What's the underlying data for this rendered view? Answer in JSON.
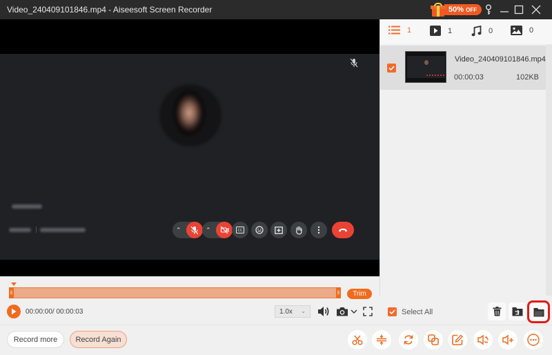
{
  "window": {
    "title": "Video_240409101846.mp4  -  Aiseesoft Screen Recorder",
    "promo_label": "50%",
    "promo_suffix": "OFF"
  },
  "player": {
    "current_time": "00:00:00",
    "total_time": "00:00:03",
    "time_display": "00:00:00/ 00:00:03",
    "speed": "1.0x",
    "trim_label": "Trim",
    "progress_fraction": 0.0
  },
  "media_tabs": [
    {
      "name": "all",
      "icon": "list-icon",
      "count": "1",
      "active": true
    },
    {
      "name": "video",
      "icon": "video-icon",
      "count": "1",
      "active": false
    },
    {
      "name": "audio",
      "icon": "music-icon",
      "count": "0",
      "active": false
    },
    {
      "name": "image",
      "icon": "image-icon",
      "count": "0",
      "active": false
    }
  ],
  "recordings": [
    {
      "filename": "Video_240409101846.mp4",
      "duration": "00:00:03",
      "size": "102KB",
      "checked": true
    }
  ],
  "list_actions": {
    "select_all_label": "Select All",
    "select_all_checked": true,
    "buttons": [
      "delete-icon",
      "export-folder-icon",
      "open-folder-icon"
    ]
  },
  "bottom": {
    "record_more_label": "Record more",
    "record_again_label": "Record Again",
    "tools": [
      "scissors-icon",
      "merge-icon",
      "convert-icon",
      "compress-icon",
      "edit-icon",
      "audio-extract-icon",
      "volume-boost-icon",
      "more-icon"
    ]
  },
  "colors": {
    "accent": "#f26b1d",
    "highlight": "#e41b17",
    "meet_red": "#ea4335"
  }
}
